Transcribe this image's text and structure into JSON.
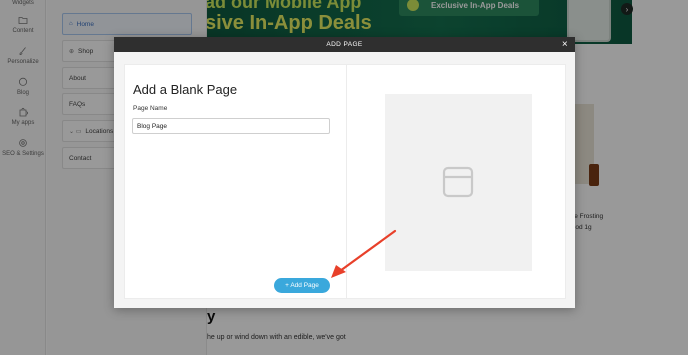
{
  "rail": {
    "items": [
      {
        "label": "Widgets",
        "icon": "widgets-icon"
      },
      {
        "label": "Content",
        "icon": "folder-icon"
      },
      {
        "label": "Personalize",
        "icon": "brush-icon"
      },
      {
        "label": "Blog",
        "icon": "chat-icon"
      },
      {
        "label": "My apps",
        "icon": "puzzle-icon"
      },
      {
        "label": "SEO & Settings",
        "icon": "gear-icon"
      }
    ]
  },
  "pages_panel": {
    "items": [
      {
        "label": "Home",
        "prefix": "⌂"
      },
      {
        "label": "Shop",
        "prefix": "⊕"
      },
      {
        "label": "About",
        "prefix": ""
      },
      {
        "label": "FAQs",
        "prefix": ""
      },
      {
        "label": "Locations",
        "prefix": "⌄ ▭"
      },
      {
        "label": "Contact",
        "prefix": ""
      }
    ]
  },
  "site": {
    "hero_line1": "ad our Mobile App",
    "hero_line2": "sive In-App Deals",
    "hero_pill": "Exclusive In-App Deals",
    "hero_next": "›",
    "product_line1": "ce Frosting",
    "product_line2": "Pod 1g",
    "heading": "y",
    "body": "he up or wind down with an edible, we've got"
  },
  "modal": {
    "header": "ADD PAGE",
    "close": "×",
    "title": "Add a Blank Page",
    "field_label": "Page Name",
    "field_value": "Blog Page",
    "button_label": "+ Add Page"
  },
  "colors": {
    "accent": "#3aa8dc",
    "hero_green": "#14704f",
    "annotation": "#e8402a"
  }
}
